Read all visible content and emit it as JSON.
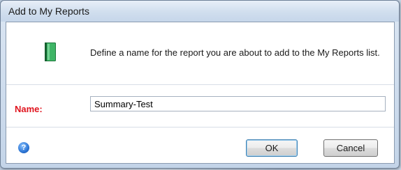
{
  "dialog": {
    "title": "Add to My Reports",
    "message": "Define a name for the report you are about to add to the My Reports list.",
    "name_label": "Name:",
    "name_value": "Summary-Test",
    "ok_label": "OK",
    "cancel_label": "Cancel",
    "help_glyph": "?"
  },
  "icons": {
    "report": "green-book-icon",
    "help": "help-icon"
  },
  "colors": {
    "name_label": "#e0141e",
    "book": "#2e9e55"
  }
}
